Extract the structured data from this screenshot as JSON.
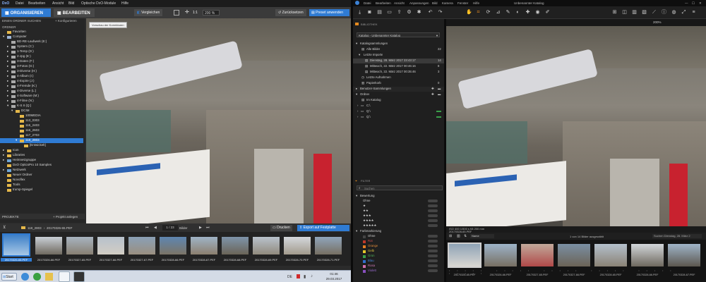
{
  "dxo": {
    "logo": "DxO",
    "menu": [
      "Datei",
      "Bearbeiten",
      "Ansicht",
      "Bild",
      "Optische DxO-Module",
      "Hilfe"
    ],
    "tabs": {
      "organize": "ORGANISIEREN",
      "edit": "BEARBEITEN"
    },
    "toolbar": {
      "compare": "Vergleichen",
      "zoom_ratio": "1:1",
      "zoom_pct": "200 %",
      "reset": "Zurücksetzen",
      "apply_preset": "Preset anwenden"
    },
    "tooltip": "Vorschau der Korrekturen",
    "left": {
      "search_folder": "EINEN ORDNER SUCHEN",
      "add_favorites": "+ Konfigurieren",
      "folders_header": "ORDNER",
      "tree": [
        "Favoriten",
        "Computer",
        "BD-RE-Laufwerk (E:)",
        "System (C:)",
        "1-Temp (D:)",
        "2-Jpg (E:)",
        "3-Daten (F:)",
        "3-Fotos (G:)",
        "3-Diverse (H:)",
        "4-Album (I:)",
        "4-Expire (J:)",
        "4-Fremde (K:)",
        "4-Diverse (L:)",
        "4-Software (M:)",
        "4-Filme (N:)",
        "K-S II (Q:)",
        "DCIM",
        "100MEDIA",
        "113_0303",
        "115_2403",
        "116_2603",
        "117_2703",
        "118_2803",
        "[Entwickelt]",
        "Icon",
        "Libraries",
        "Heimnetzgruppe",
        "DxO OpticsPro 10 Samples",
        "Netzwerk",
        "Neuer Ordner",
        "Novoflex",
        "Tools",
        "trump-Spiegel"
      ],
      "projects_header": "PROJEKTE",
      "add_project": "+ Projekt anlegen"
    },
    "filmbar": {
      "folder": "118_2803",
      "file": "20170326-65.PEF",
      "counter": "1 / 23",
      "counter_label": "Bilder",
      "print": "Drucken",
      "export": "Export auf Festplatte"
    },
    "thumbs": [
      "20170326-65.PEF",
      "20170326-66.PEF",
      "20170327-65.PEF",
      "20170327-66.PEF",
      "20170327-67.PEF",
      "20170328-66.PEF",
      "20170328-67.PEF",
      "20170328-68.PEF",
      "20170328-69.PEF",
      "20170328-70.PEF",
      "20170328-71.PEF"
    ]
  },
  "taskbar": {
    "start": "Start",
    "time": "01:46",
    "date": "29.03.2017",
    "lang": "DE"
  },
  "lr": {
    "menu": [
      "Datei",
      "Bearbeiten",
      "Ansicht",
      "Anpassungen",
      "Bild",
      "Kamera",
      "Fenster",
      "Hilfe"
    ],
    "window_title": "Unbenannter Katalog",
    "library_label": "BIBLIOTHEK",
    "catalog_select": "Katalog - Unbenannter Katalog",
    "zoom": "200%",
    "sections": {
      "catalog_collections": "Katalogsammlungen",
      "all_images": "Alle Bilder",
      "all_count": "22",
      "last_imports": "Letzte Importe",
      "imports": [
        {
          "label": "Dienstag, 28. März 2017 23:43:17",
          "count": "14"
        },
        {
          "label": "Mittwoch, 22. März 2017 00:46:16",
          "count": "8"
        },
        {
          "label": "Mittwoch, 22. März 2017 00:35:46",
          "count": "3"
        }
      ],
      "last_captured": "Letzte Aufnahmen",
      "trash": "Papierkorb",
      "trash_count": "0",
      "user_collections": "Benutzer-Sammlungen",
      "folders": "Ordner",
      "in_catalog": "Im Katalog",
      "drives": [
        "C:\\",
        "Q:\\",
        "Q:\\"
      ]
    },
    "filters_label": "FILTER",
    "search_placeholder": "Suchen",
    "rating_label": "Bewertung",
    "ratings": [
      "Ohne",
      "★",
      "★★",
      "★★★",
      "★★★★",
      "★★★★★"
    ],
    "color_label": "Farbmarkierung",
    "colors": [
      {
        "name": "Ohne",
        "hex": "#444444"
      },
      {
        "name": "Rot",
        "hex": "#c0392b"
      },
      {
        "name": "Orange",
        "hex": "#e67e22"
      },
      {
        "name": "Gelb",
        "hex": "#e5c62a"
      },
      {
        "name": "Grün",
        "hex": "#3aa04a"
      },
      {
        "name": "Blau",
        "hex": "#2f6fd0"
      },
      {
        "name": "Rosa",
        "hex": "#d06fb0"
      },
      {
        "name": "Violett",
        "hex": "#8a4fc0"
      }
    ],
    "photo_info": "ISO 400 1/500 s f/8 200 mm",
    "file_info": "20170328-65.PEF",
    "selection_info": "1 von 14 Bilder ausgewählt",
    "sort_label": "Name",
    "search_info": "Suchen Dienstag, 28. März 2",
    "thumbs": [
      "20170326-65.PEF",
      "20170326-66.PEF",
      "20170327-65.PEF",
      "20170327-66.PEF",
      "20170328-65.PEF",
      "20170328-66.PEF",
      "20170328-67.PEF"
    ]
  },
  "colors": {
    "dxo_accent": "#2f7bd3",
    "folder": "#e5b84a",
    "lr_accent": "#e58a1f",
    "selected_row": "#3a3a3a"
  }
}
